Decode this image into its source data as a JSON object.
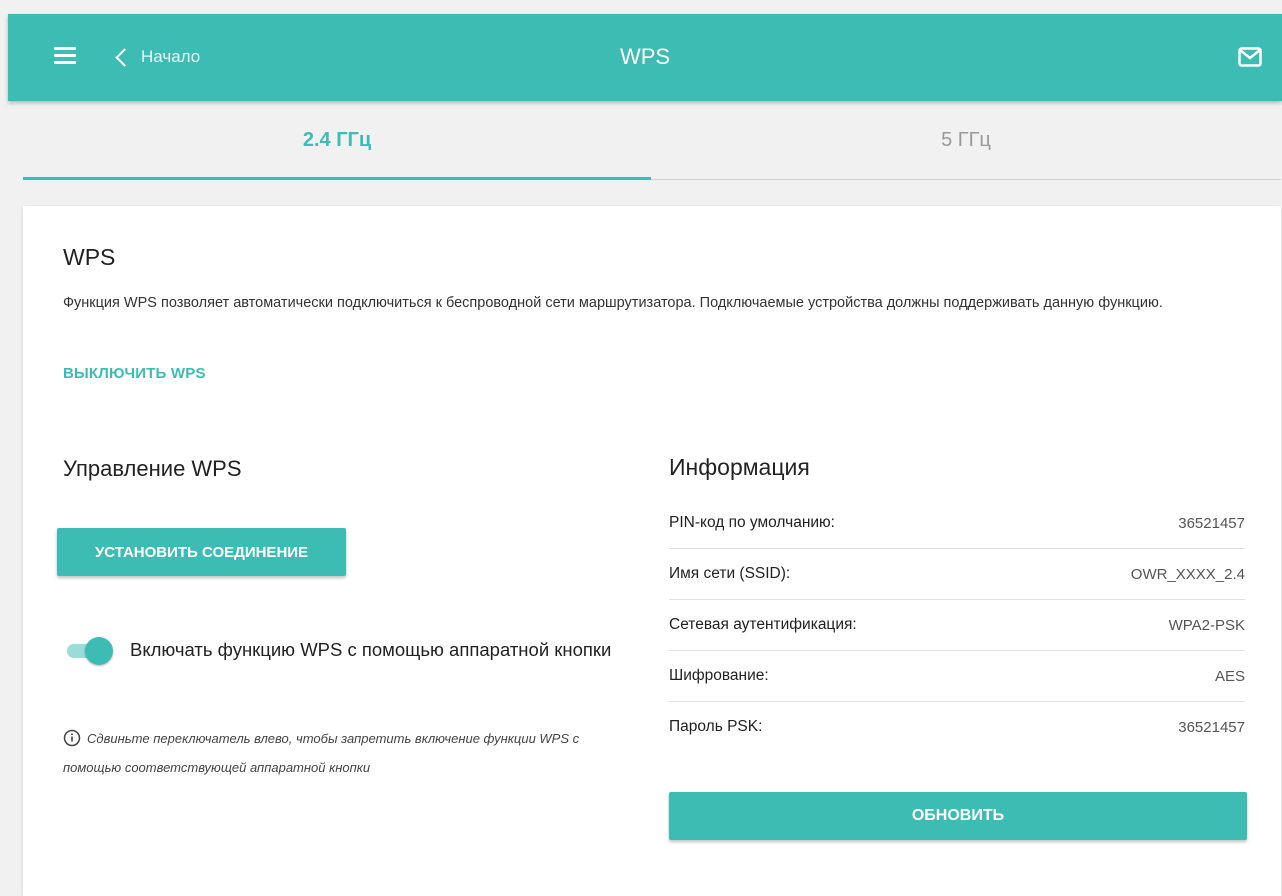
{
  "header": {
    "back_label": "Начало",
    "title": "WPS",
    "menu_icon": "hamburger-menu-icon",
    "mail_icon": "mail-icon"
  },
  "tabs": [
    {
      "label": "2.4 ГГц",
      "active": true
    },
    {
      "label": "5 ГГц",
      "active": false
    }
  ],
  "wps": {
    "heading": "WPS",
    "description": "Функция WPS позволяет автоматически подключиться к беспроводной сети маршрутизатора. Подключаемые устройства должны поддерживать данную функцию.",
    "disable_link": "ВЫКЛЮЧИТЬ WPS"
  },
  "management": {
    "heading": "Управление WPS",
    "connect_button": "УСТАНОВИТЬ СОЕДИНЕНИЕ",
    "hw_button_toggle": {
      "label": "Включать функцию WPS с помощью аппаратной кнопки",
      "on": true
    },
    "hint": "Сдвиньте переключатель влево, чтобы запретить включение функции WPS с помощью соответствующей аппаратной кнопки"
  },
  "info": {
    "heading": "Информация",
    "rows": [
      {
        "key": "PIN-код по умолчанию:",
        "value": "36521457"
      },
      {
        "key": "Имя сети (SSID):",
        "value": "OWR_XXXX_2.4"
      },
      {
        "key": "Сетевая аутентификация:",
        "value": "WPA2-PSK"
      },
      {
        "key": "Шифрование:",
        "value": "AES"
      },
      {
        "key": "Пароль PSK:",
        "value": "36521457"
      }
    ],
    "refresh_button": "ОБНОВИТЬ"
  },
  "colors": {
    "accent": "#3dbcb4",
    "accent_light": "#9adcd7",
    "background": "#f1f1f1"
  }
}
